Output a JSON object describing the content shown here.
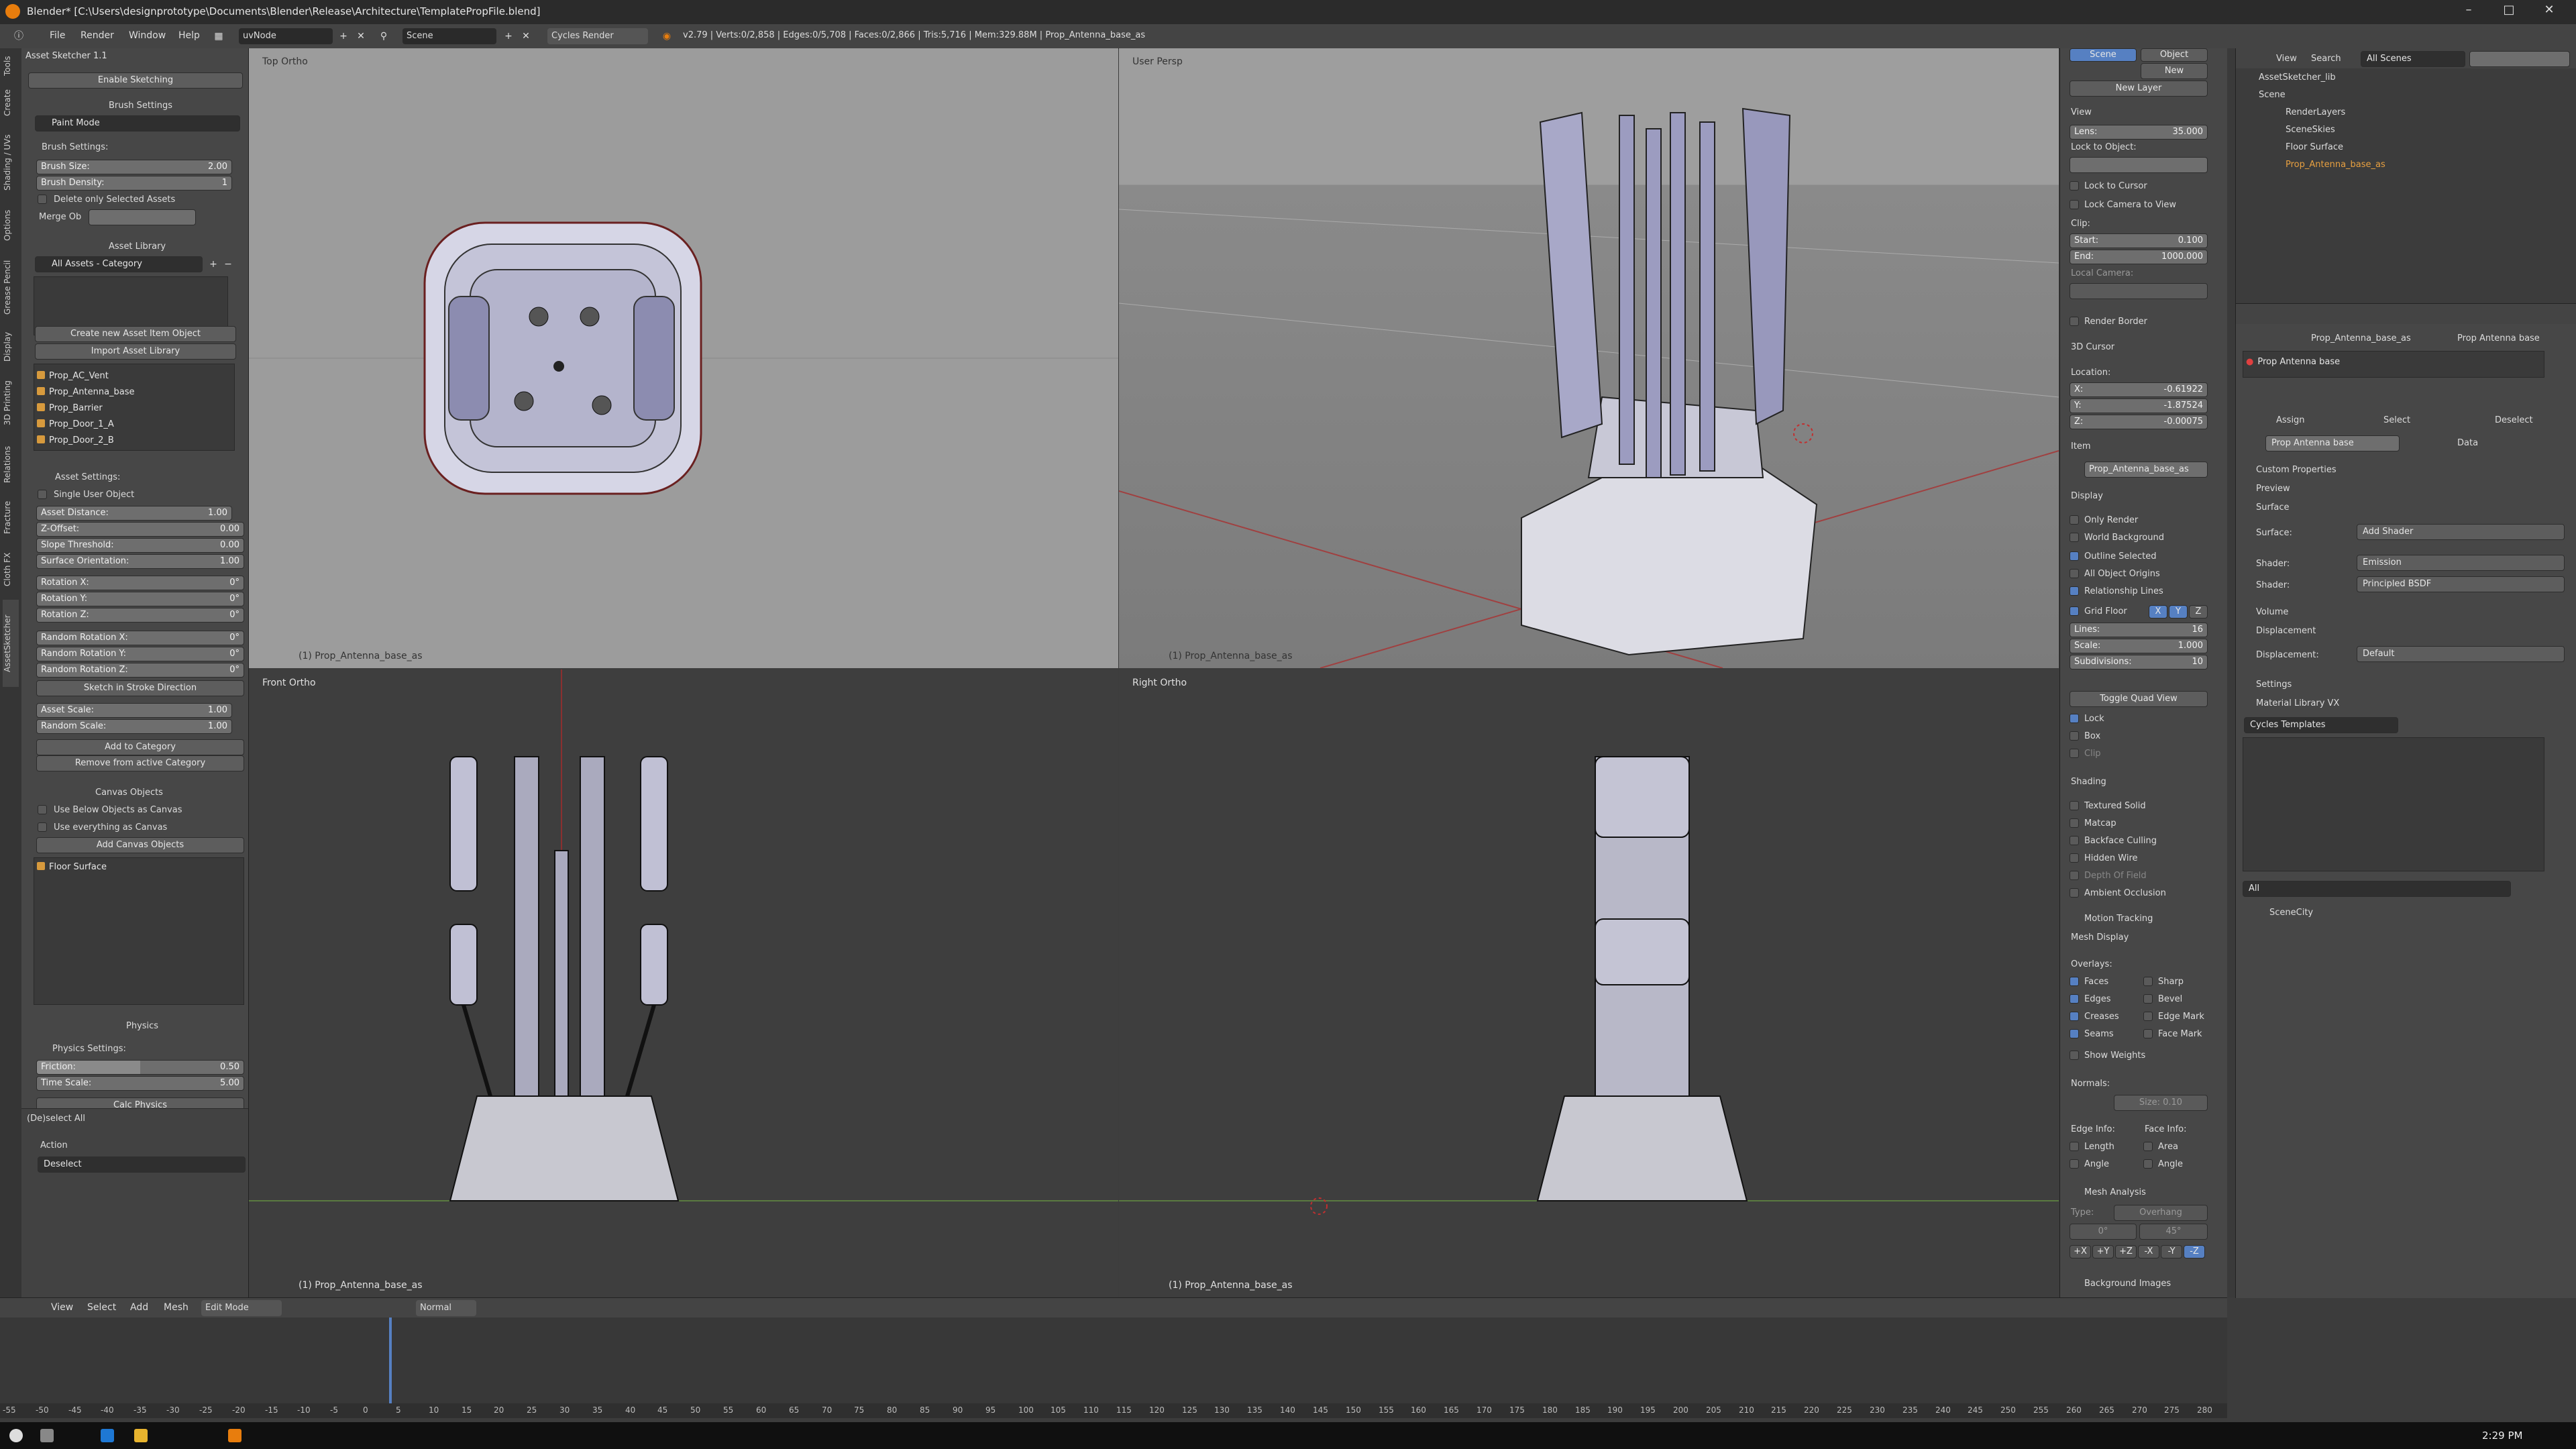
{
  "window": {
    "title": "Blender* [C:\\Users\\designprototype\\Documents\\Blender\\Release\\Architecture\\TemplatePropFile.blend]",
    "buttons": [
      "–",
      "□",
      "✕"
    ]
  },
  "menubar": {
    "menus": [
      "File",
      "Render",
      "Window",
      "Help"
    ],
    "screen": "uvNode",
    "scene": "Scene",
    "engine": "Cycles Render",
    "stats": "v2.79 | Verts:0/2,858 | Edges:0/5,708 | Faces:0/2,866 | Tris:5,716 | Mem:329.88M | Prop_Antenna_base_as"
  },
  "tool_tabs": [
    "Tools",
    "Create",
    "Shading / UVs",
    "Options",
    "Grease Pencil",
    "Display",
    "3D Printing",
    "Relations",
    "Fracture",
    "Cloth FX",
    "AssetSketcher"
  ],
  "left_panel": {
    "header": "Asset Sketcher 1.1",
    "enable_sketching": "Enable Sketching",
    "brush_settings_title": "Brush Settings",
    "paint_mode": "Paint Mode",
    "brush_settings_label": "Brush Settings:",
    "brush_size": {
      "label": "Brush Size:",
      "value": "2.00"
    },
    "brush_density": {
      "label": "Brush Density:",
      "value": "1"
    },
    "delete_only_selected": "Delete only Selected Assets",
    "merge_ob": "Merge Ob",
    "asset_library_title": "Asset Library",
    "category": "All Assets - Category",
    "create_new_asset": "Create new Asset Item Object",
    "import_asset_library": "Import Asset Library",
    "assets": [
      "Prop_AC_Vent",
      "Prop_Antenna_base",
      "Prop_Barrier",
      "Prop_Door_1_A",
      "Prop_Door_2_B"
    ],
    "asset_settings_label": "Asset Settings:",
    "single_user_object": "Single User Object",
    "fields": [
      {
        "label": "Asset Distance:",
        "value": "1.00"
      },
      {
        "label": "Z-Offset:",
        "value": "0.00"
      },
      {
        "label": "Slope Threshold:",
        "value": "0.00"
      },
      {
        "label": "Surface Orientation:",
        "value": "1.00"
      },
      {
        "label": "Rotation X:",
        "value": "0°"
      },
      {
        "label": "Rotation Y:",
        "value": "0°"
      },
      {
        "label": "Rotation Z:",
        "value": "0°"
      },
      {
        "label": "Random Rotation X:",
        "value": "0°"
      },
      {
        "label": "Random Rotation Y:",
        "value": "0°"
      },
      {
        "label": "Random Rotation Z:",
        "value": "0°"
      }
    ],
    "sketch_in_stroke": "Sketch in Stroke Direction",
    "asset_scale": {
      "label": "Asset Scale:",
      "value": "1.00"
    },
    "random_scale": {
      "label": "Random Scale:",
      "value": "1.00"
    },
    "add_to_category": "Add to Category",
    "remove_from_category": "Remove from active Category",
    "canvas_objects_title": "Canvas Objects",
    "use_below_objects": "Use Below Objects as Canvas",
    "use_everything": "Use everything as Canvas",
    "add_canvas_objects": "Add Canvas Objects",
    "canvas_item": "Floor Surface",
    "physics_title": "Physics",
    "physics_settings": "Physics Settings:",
    "friction": {
      "label": "Friction:",
      "value": "0.50"
    },
    "time_scale": {
      "label": "Time Scale:",
      "value": "5.00"
    },
    "calc_physics": "Calc Physics",
    "operator_title": "(De)select All",
    "action_label": "Action",
    "action_value": "Deselect"
  },
  "viewports": {
    "top_left": {
      "label": "Top Ortho",
      "foot": "(1) Prop_Antenna_base_as"
    },
    "top_right": {
      "label": "User Persp",
      "foot": "(1) Prop_Antenna_base_as"
    },
    "bottom_left": {
      "label": "Front Ortho",
      "foot": "(1) Prop_Antenna_base_as"
    },
    "bottom_right": {
      "label": "Right Ortho",
      "foot": "(1) Prop_Antenna_base_as"
    }
  },
  "n_panel": {
    "tabs": [
      "Scene",
      "Object"
    ],
    "new_btn": "New",
    "new_layer": "New Layer",
    "view_title": "View",
    "lens": {
      "label": "Lens:",
      "value": "35.000"
    },
    "lock_to_object": "Lock to Object:",
    "lock_to_cursor": "Lock to Cursor",
    "lock_camera": "Lock Camera to View",
    "clip_label": "Clip:",
    "clip_start": {
      "label": "Start:",
      "value": "0.100"
    },
    "clip_end": {
      "label": "End:",
      "value": "1000.000"
    },
    "local_camera": "Local Camera:",
    "render_border": "Render Border",
    "cursor_title": "3D Cursor",
    "location_label": "Location:",
    "cursor_x": {
      "label": "X:",
      "value": "-0.61922"
    },
    "cursor_y": {
      "label": "Y:",
      "value": "-1.87524"
    },
    "cursor_z": {
      "label": "Z:",
      "value": "-0.00075"
    },
    "item_title": "Item",
    "item_name": "Prop_Antenna_base_as",
    "display_title": "Display",
    "display_opts": [
      "Only Render",
      "World Background",
      "Outline Selected",
      "All Object Origins",
      "Relationship Lines"
    ],
    "grid_floor": "Grid Floor",
    "axes": [
      "X",
      "Y",
      "Z"
    ],
    "lines": {
      "label": "Lines:",
      "value": "16"
    },
    "scale": {
      "label": "Scale:",
      "value": "1.000"
    },
    "subdivisions": {
      "label": "Subdivisions:",
      "value": "10"
    },
    "toggle_quad": "Toggle Quad View",
    "quad_opts": [
      "Lock",
      "Box",
      "Clip"
    ],
    "shading_title": "Shading",
    "shading_opts": [
      "Textured Solid",
      "Matcap",
      "Backface Culling",
      "Hidden Wire",
      "Depth Of Field",
      "Ambient Occlusion"
    ],
    "motion_tracking": "Motion Tracking",
    "mesh_display_title": "Mesh Display",
    "overlays_label": "Overlays:",
    "overlays_left": [
      "Faces",
      "Edges",
      "Creases",
      "Seams"
    ],
    "overlays_right": [
      "Sharp",
      "Bevel",
      "Edge Mark",
      "Face Mark"
    ],
    "show_weights": "Show Weights",
    "normals_label": "Normals:",
    "normals_size": "Size: 0.10",
    "edge_info": "Edge Info:",
    "face_info": "Face Info:",
    "edge_info_opts": [
      "Length",
      "Angle"
    ],
    "face_info_opts": [
      "Area",
      "Angle"
    ],
    "mesh_analysis": "Mesh Analysis",
    "type_label": "Type:",
    "type_value": "Overhang",
    "analysis_min": "0°",
    "analysis_max": "45°",
    "axis_btns": [
      "+X",
      "+Y",
      "+Z",
      "-X",
      "-Y",
      "-Z"
    ],
    "background_images": "Background Images"
  },
  "outliner": {
    "menus": [
      "View",
      "Search"
    ],
    "scenes": "All Scenes",
    "rows": [
      "AssetSketcher_lib",
      "Scene",
      "RenderLayers",
      "SceneSkies",
      "Floor Surface",
      "Prop_Antenna_base_as"
    ]
  },
  "properties": {
    "path_a": "Prop_Antenna_base_as",
    "path_b": "Prop Antenna base",
    "material_slot": "Prop Antenna base",
    "assign": "Assign",
    "select": "Select",
    "deselect": "Deselect",
    "material_name": "Prop Antenna base",
    "data_label": "Data",
    "sections": [
      "Custom Properties",
      "Preview",
      "Surface"
    ],
    "surface_label": "Surface:",
    "surface_value": "Add Shader",
    "shader1": {
      "label": "Shader:",
      "value": "Emission"
    },
    "shader2": {
      "label": "Shader:",
      "value": "Principled BSDF"
    },
    "volume": "Volume",
    "displacement_title": "Displacement",
    "displacement_label": "Displacement:",
    "displacement_value": "Default",
    "settings": "Settings",
    "material_library": "Material Library VX",
    "templates": "Cycles Templates",
    "filter_all": "All",
    "scene_city": "SceneCity"
  },
  "view3d_header": {
    "menus": [
      "View",
      "Select",
      "Add",
      "Mesh"
    ],
    "mode": "Edit Mode",
    "orientation": "Normal"
  },
  "timeline": {
    "ticks": [
      "-55",
      "-50",
      "-45",
      "-40",
      "-35",
      "-30",
      "-25",
      "-20",
      "-15",
      "-10",
      "-5",
      "0",
      "5",
      "10",
      "15",
      "20",
      "25",
      "30",
      "35",
      "40",
      "45",
      "50",
      "55",
      "60",
      "65",
      "70",
      "75",
      "80",
      "85",
      "90",
      "95",
      "100",
      "105",
      "110",
      "115",
      "120",
      "125",
      "130",
      "135",
      "140",
      "145",
      "150",
      "155",
      "160",
      "165",
      "170",
      "175",
      "180",
      "185",
      "190",
      "195",
      "200",
      "205",
      "210",
      "215",
      "220",
      "225",
      "230",
      "235",
      "240",
      "245",
      "250",
      "255",
      "260",
      "265",
      "270",
      "275",
      "280"
    ]
  },
  "taskbar": {
    "time": "2:29 PM"
  },
  "colors": {
    "accent": "#e87d0d",
    "select_blue": "#5680c2",
    "viewport_top": "#9c9c9c",
    "viewport_bottom": "#3d3d3d",
    "orange_item": "#d79a3d"
  }
}
